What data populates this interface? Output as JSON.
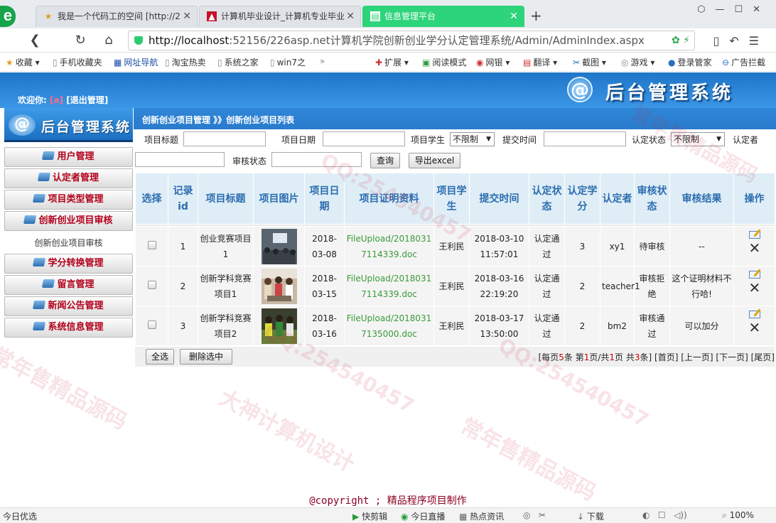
{
  "browser": {
    "tabs": [
      {
        "title": "我是一个代码工的空间 [http://2",
        "active": false
      },
      {
        "title": "计算机毕业设计_计算机专业毕业",
        "active": false
      },
      {
        "title": "信息管理平台",
        "active": true
      }
    ],
    "url_host": "http://localhost",
    "url_path": ":52156/226asp.net计算机学院创新创业学分认定管理系统/Admin/AdminIndex.aspx",
    "bookmarks": [
      "收藏",
      "手机收藏夹",
      "网址导航",
      "淘宝热卖",
      "系统之家",
      "win7之",
      "扩展",
      "阅读模式",
      "网银",
      "翻译",
      "截图",
      "游戏",
      "登录管家",
      "广告拦截"
    ]
  },
  "header": {
    "welcome_label": "欢迎你:",
    "username": "[a]",
    "logout": "[退出管理]",
    "brand_title": "后台管理系统",
    "brand_symbol": "@"
  },
  "sidebar": {
    "logo_text": "后台管理系统",
    "items": [
      {
        "label": "用户管理",
        "type": "menu"
      },
      {
        "label": "认定者管理",
        "type": "menu"
      },
      {
        "label": "项目类型管理",
        "type": "menu"
      },
      {
        "label": "创新创业项目审核",
        "type": "menu"
      },
      {
        "label": "创新创业项目审核",
        "type": "sub"
      },
      {
        "label": "学分转换管理",
        "type": "menu"
      },
      {
        "label": "留言管理",
        "type": "menu"
      },
      {
        "label": "新闻公告管理",
        "type": "menu"
      },
      {
        "label": "系统信息管理",
        "type": "menu"
      }
    ]
  },
  "breadcrumb": "创新创业项目管理 》》创新创业项目列表",
  "search": {
    "title_label": "项目标题",
    "date_label": "项目日期",
    "student_label": "项目学生",
    "student_value": "不限制",
    "submit_label": "提交时间",
    "status_label": "认定状态",
    "status_value": "不限制",
    "certifier_label": "认定者",
    "review_label": "审核状态",
    "query_button": "查询",
    "export_button": "导出excel"
  },
  "table": {
    "columns": [
      "选择",
      "记录id",
      "项目标题",
      "项目图片",
      "项目日期",
      "项目证明资料",
      "项目学生",
      "提交时间",
      "认定状态",
      "认定学分",
      "认定者",
      "审核状态",
      "审核结果",
      "操作"
    ],
    "rows": [
      {
        "id": "1",
        "title": "创业竞赛项目1",
        "date": "2018-03-08",
        "file": "FileUpload/20180317114339.doc",
        "student": "王利民",
        "submit_time": "2018-03-10 11:57:01",
        "cert_status": "认定通过",
        "credit": "3",
        "certifier": "xy1",
        "review_status": "待审核",
        "review_result": "--"
      },
      {
        "id": "2",
        "title": "创新学科竞赛项目1",
        "date": "2018-03-15",
        "file": "FileUpload/20180317114339.doc",
        "student": "王利民",
        "submit_time": "2018-03-16 22:19:20",
        "cert_status": "认定通过",
        "credit": "2",
        "certifier": "teacher1",
        "review_status": "审核拒绝",
        "review_result": "这个证明材料不行哈!"
      },
      {
        "id": "3",
        "title": "创新学科竞赛项目2",
        "date": "2018-03-16",
        "file": "FileUpload/20180317135000.doc",
        "student": "王利民",
        "submit_time": "2018-03-17 13:50:00",
        "cert_status": "认定通过",
        "credit": "2",
        "certifier": "bm2",
        "review_status": "审核通过",
        "review_result": "可以加分"
      }
    ]
  },
  "footer": {
    "select_all": "全选",
    "delete_selected": "删除选中",
    "pager_prefix": "[每页",
    "per_page": "5",
    "pager_mid1": "条 第",
    "current_page": "1",
    "pager_mid2": "页/共",
    "total_pages": "1",
    "pager_mid3": "页 共",
    "total_items": "3",
    "pager_suffix": "条]",
    "first": "[首页]",
    "prev": "[上一页]",
    "next": "[下一页]",
    "last": "[尾页]"
  },
  "copyright": "@copyright ; 精品程序项目制作",
  "statusbar": {
    "left": "今日优选",
    "items": [
      "快剪辑",
      "今日直播",
      "热点资讯",
      "下载",
      "100%"
    ]
  },
  "watermarks": [
    "常年售精品源码",
    "QQ:254540457",
    "大神计算机设计"
  ]
}
